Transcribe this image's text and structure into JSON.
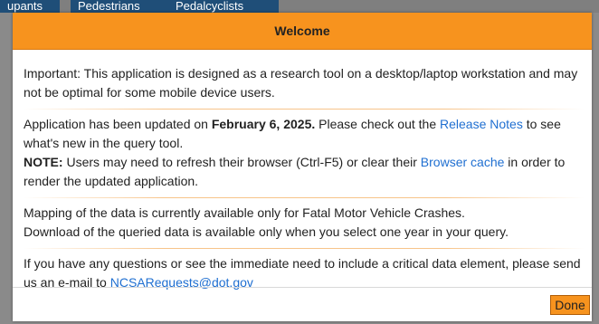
{
  "background": {
    "tabs": [
      {
        "label": "upants"
      },
      {
        "label": "Pedestrians"
      },
      {
        "label": "Pedalcyclists"
      }
    ]
  },
  "modal": {
    "title": "Welcome",
    "important": "Important: This application is designed as a research tool on a desktop/laptop workstation and may not be optimal for some mobile device users.",
    "update": {
      "prefix": "Application has been updated on ",
      "date": "February 6, 2025.",
      "middle": " Please check out the ",
      "release_notes_link": "Release Notes",
      "suffix": " to see what's new in the query tool."
    },
    "note": {
      "label": "NOTE:",
      "text_before": " Users may need to refresh their browser (Ctrl-F5) or clear their ",
      "cache_link": "Browser cache",
      "text_after": " in order to render the updated application."
    },
    "mapping": "Mapping of the data is currently available only for Fatal Motor Vehicle Crashes.",
    "download": "Download of the queried data is available only when you select one year in your query.",
    "contact": {
      "text": "If you have any questions or see the immediate need to include a critical data element, please send us an e-mail to ",
      "email_link": "NCSARequests@dot.gov"
    },
    "done_label": "Done"
  },
  "colors": {
    "header": "#f7931e",
    "link": "#1f6fd1",
    "tab": "#1f4e78"
  }
}
